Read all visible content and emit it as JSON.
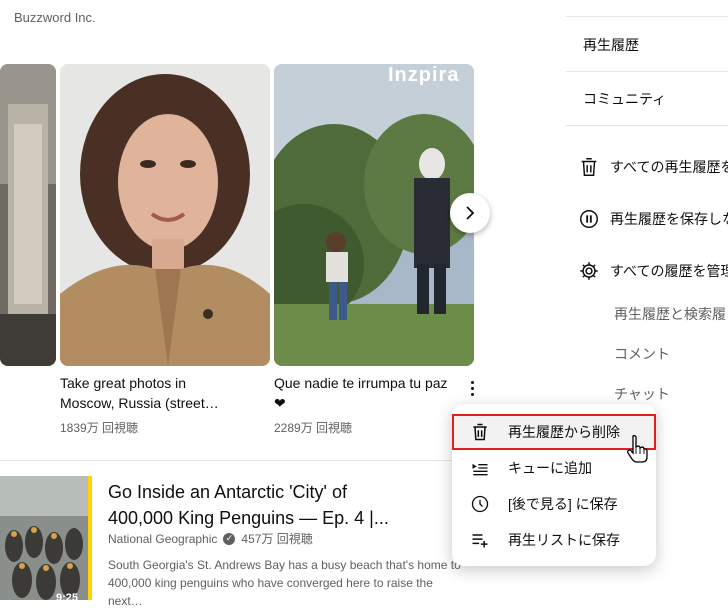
{
  "header": {
    "channel_name": "Buzzword Inc."
  },
  "shorts": [
    {
      "title_line1": "Take great photos in",
      "title_line2": "Moscow, Russia (street…",
      "views": "1839万 回視聴"
    },
    {
      "title_line1": "Que nadie te irrumpa tu paz",
      "title_line2": "❤",
      "views": "2289万 回視聴",
      "overlay_text": "Inzpira"
    }
  ],
  "video": {
    "title_line1": "Go Inside an Antarctic 'City' of",
    "title_line2": "400,000 King Penguins — Ep. 4 |...",
    "channel": "National Geographic",
    "verified": "✓",
    "views": "457万 回視聴",
    "desc_line1": "South Georgia's St. Andrews Bay has a busy beach that's home to",
    "desc_line2": "400,000 king penguins who have converged here to raise the next…",
    "duration": "9:25"
  },
  "sidebar": {
    "items": [
      {
        "label": "再生履歴"
      },
      {
        "label": "コミュニティ"
      }
    ],
    "actions": [
      {
        "label": "すべての再生履歴を",
        "icon": "trash-icon"
      },
      {
        "label": "再生履歴を保存しな",
        "icon": "pause-circle-icon"
      },
      {
        "label": "すべての履歴を管理",
        "icon": "gear-icon"
      }
    ],
    "sub_items": [
      {
        "label": "再生履歴と検索履"
      },
      {
        "label": "コメント"
      },
      {
        "label": "チャット"
      }
    ]
  },
  "menu": {
    "items": [
      {
        "label": "再生履歴から削除",
        "icon": "trash-icon",
        "highlighted": true
      },
      {
        "label": "キューに追加",
        "icon": "queue-icon"
      },
      {
        "label": "[後で見る] に保存",
        "icon": "clock-icon"
      },
      {
        "label": "再生リストに保存",
        "icon": "playlist-add-icon"
      }
    ]
  },
  "colors": {
    "highlight_border": "#e02020",
    "accent_yellow": "#ffd200",
    "text_secondary": "#606060"
  }
}
